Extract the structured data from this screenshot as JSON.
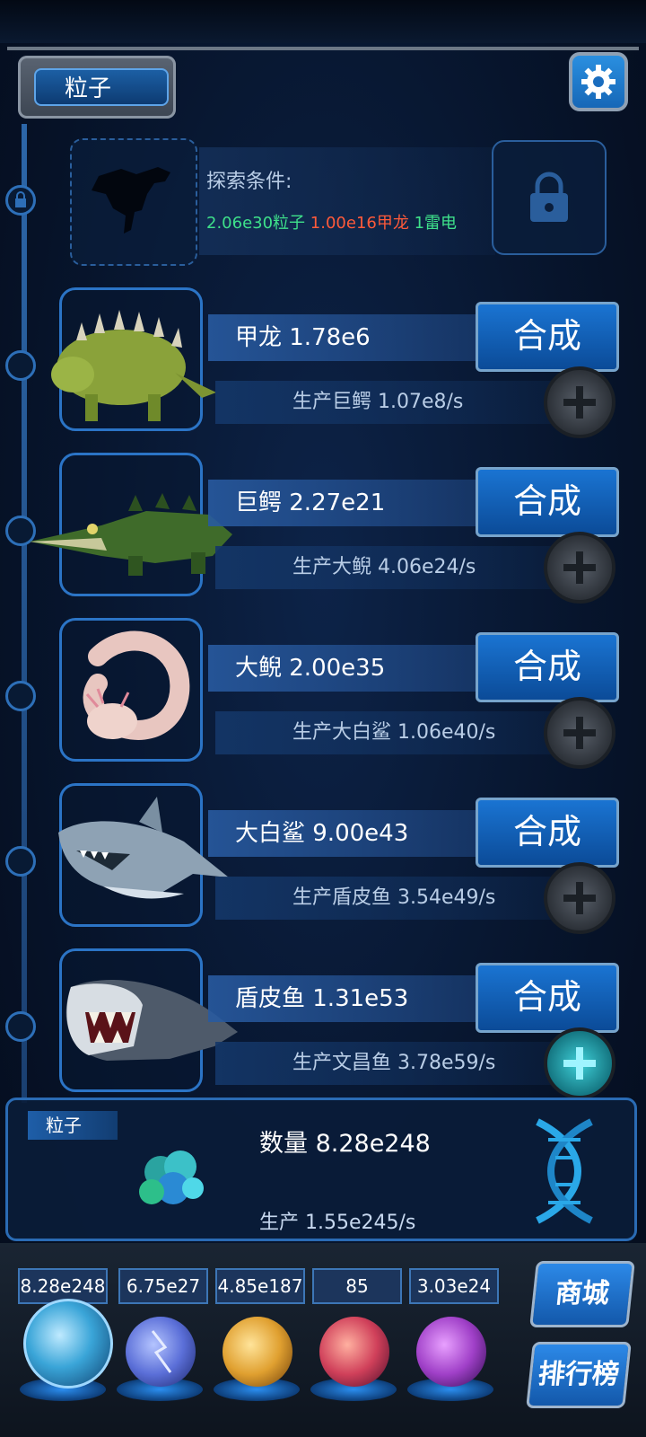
{
  "header": {
    "resource_tab": "粒子"
  },
  "locked_creature": {
    "label": "探索条件:",
    "requirements": [
      {
        "text": "2.06e30粒子",
        "color": "#3ee08a"
      },
      {
        "text": "1.00e16甲龙",
        "color": "#ff5a3a"
      },
      {
        "text": "1雷电",
        "color": "#3ee08a"
      }
    ],
    "icon": "lock-icon"
  },
  "creatures": [
    {
      "name": "甲龙 1.78e6",
      "merge": "合成",
      "produce": "生产巨鳄 1.07e8/s",
      "plus_active": false
    },
    {
      "name": "巨鳄 2.27e21",
      "merge": "合成",
      "produce": "生产大鲵 4.06e24/s",
      "plus_active": false
    },
    {
      "name": "大鲵 2.00e35",
      "merge": "合成",
      "produce": "生产大白鲨 1.06e40/s",
      "plus_active": false
    },
    {
      "name": "大白鲨 9.00e43",
      "merge": "合成",
      "produce": "生产盾皮鱼 3.54e49/s",
      "plus_active": false
    },
    {
      "name": "盾皮鱼 1.31e53",
      "merge": "合成",
      "produce": "生产文昌鱼 3.78e59/s",
      "plus_active": true
    }
  ],
  "resource_panel": {
    "tab": "粒子",
    "count": "数量 8.28e248",
    "production": "生产 1.55e245/s"
  },
  "dock": {
    "resources": [
      {
        "value": "8.28e248",
        "orb_color": "#3aa5d8"
      },
      {
        "value": "6.75e27",
        "orb_color": "#5b6fd8"
      },
      {
        "value": "4.85e187",
        "orb_color": "#e0a030"
      },
      {
        "value": "85",
        "orb_color": "#d0405a"
      },
      {
        "value": "3.03e24",
        "orb_color": "#a040c8"
      }
    ],
    "shop": "商城",
    "leaderboard": "排行榜"
  }
}
